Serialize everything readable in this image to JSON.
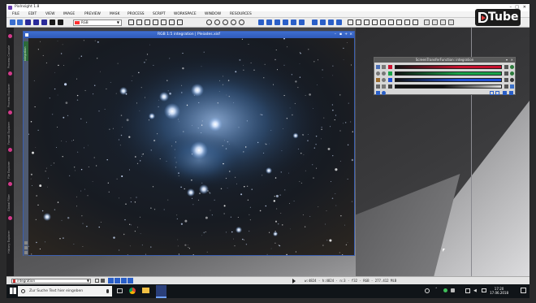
{
  "app": {
    "title": "PixInsight 1.8",
    "menu": [
      "FILE",
      "EDIT",
      "VIEW",
      "IMAGE",
      "PREVIEW",
      "MASK",
      "PROCESS",
      "SCRIPT",
      "WORKSPACE",
      "WINDOW",
      "RESOURCES"
    ],
    "view_selector_value": "RGB"
  },
  "image_window": {
    "title": "RGB 1:5 integration | Pleiades.xisf",
    "side_label": "integration"
  },
  "sidebar_tabs": [
    "Process Console",
    "Process Explorer",
    "Format Explorer",
    "File Explorer",
    "Global Filter",
    "History Explorer"
  ],
  "stf_window": {
    "title": "ScreenTransferFunction: integration",
    "bars": [
      {
        "channel": "R",
        "color": "#c8102e"
      },
      {
        "channel": "G",
        "color": "#1aa34a"
      },
      {
        "channel": "B",
        "color": "#1f4fd6"
      },
      {
        "channel": "L",
        "color": "#8a8a8a"
      }
    ]
  },
  "statusbar": {
    "view_value": "integration",
    "info": "w:4824 · h:4824 · n:3 · f32 · RGB · 277.412 MiB"
  },
  "taskbar": {
    "search_placeholder": "Zur Suche Text hier eingeben",
    "time": "17:20",
    "date": "17.06.2018"
  },
  "watermark": {
    "text": "Tube"
  },
  "colors": {
    "accent_blue": "#2f59b6",
    "menu_bg": "#f3f3f3",
    "taskbar_bg": "#101418"
  }
}
